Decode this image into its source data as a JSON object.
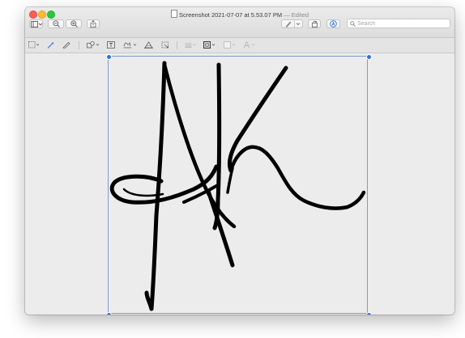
{
  "window": {
    "title": "Screenshot 2021-07-07 at 5.53.07 PM",
    "edited_suffix": " — Edited"
  },
  "toolbar": {
    "sidebar_button": "sidebar-icon",
    "zoom_out_button": "zoom-out-icon",
    "zoom_in_button": "zoom-in-icon",
    "share_button": "share-icon",
    "highlight_button": "pencil-icon",
    "rotate_button": "rotate-icon",
    "markup_button": "markup-icon"
  },
  "search": {
    "placeholder": "Search",
    "value": ""
  },
  "markup_tools": [
    "selection-tools-icon",
    "instant-alpha-icon",
    "sketch-icon",
    "shapes-icon",
    "text-icon",
    "sign-icon",
    "adjust-color-icon",
    "adjust-size-icon",
    "shape-style-icon",
    "border-color-icon",
    "fill-color-icon",
    "text-style-icon"
  ],
  "colors": {
    "accent": "#2f6fde",
    "selection_border": "#7d9ccf",
    "signature_ink": "#000000"
  }
}
